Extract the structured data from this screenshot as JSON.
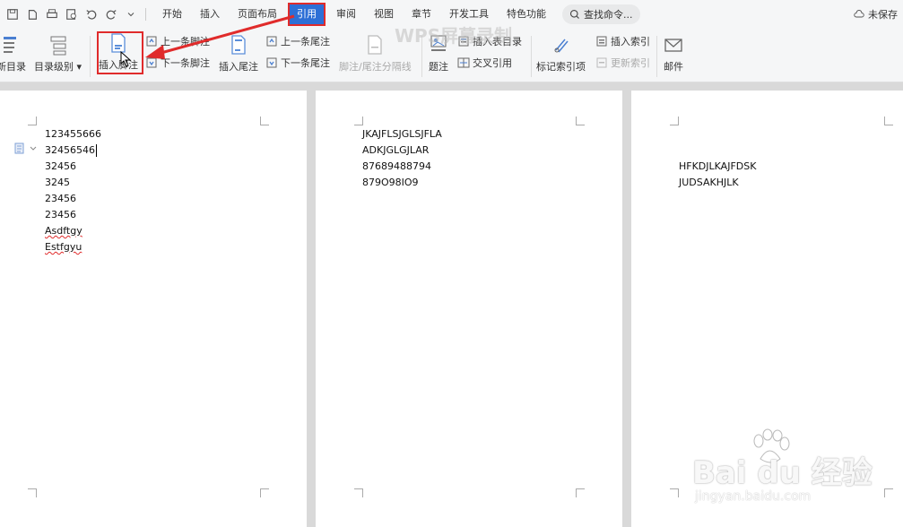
{
  "menubar": {
    "tabs": [
      "开始",
      "插入",
      "页面布局",
      "引用",
      "审阅",
      "视图",
      "章节",
      "开发工具",
      "特色功能"
    ],
    "active_tab": "引用",
    "search_label": "查找命令...",
    "save_status": "未保存"
  },
  "ribbon": {
    "toc_update": "新目录",
    "toc_level": "目录级别",
    "insert_footnote": "插入脚注",
    "prev_footnote": "上一条脚注",
    "next_footnote": "下一条脚注",
    "insert_endnote": "插入尾注",
    "prev_endnote": "上一条尾注",
    "next_endnote": "下一条尾注",
    "separator": "脚注/尾注分隔线",
    "caption": "题注",
    "insert_toc_figures": "插入表目录",
    "cross_reference": "交叉引用",
    "mark_index": "标记索引项",
    "insert_index": "插入索引",
    "update_index": "更新索引",
    "mail": "邮件"
  },
  "document": {
    "page1_lines": [
      "123455666",
      "32456546",
      "32456",
      "3245",
      "23456",
      "23456",
      "Asdftgy",
      "Estfgyu"
    ],
    "page2_lines": [
      "JKAJFLSJGLSJFLA",
      "ADKJGLGJLAR",
      "87689488794",
      "879O98IO9"
    ],
    "page3_lines": [
      "HFKDJLKAJFDSK",
      "JUDSAKHJLK"
    ]
  },
  "watermarks": {
    "wps": "WPS屏幕录制",
    "baidu": "Bai du 经验",
    "baidu_url": "jingyan.baidu.com"
  },
  "colors": {
    "accent": "#2d6fd6",
    "highlight_red": "#e02b2b"
  }
}
